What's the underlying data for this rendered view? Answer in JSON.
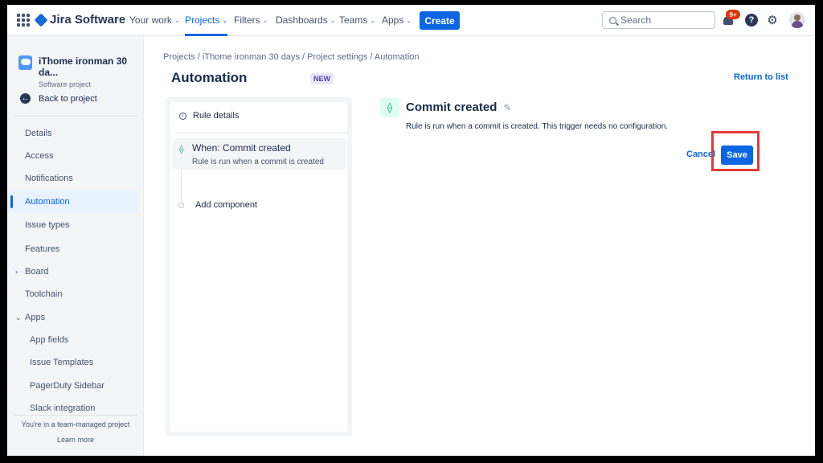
{
  "nav": {
    "app_name": "Jira Software",
    "items": [
      {
        "label": "Your work",
        "active": false
      },
      {
        "label": "Projects",
        "active": true
      },
      {
        "label": "Filters",
        "active": false
      },
      {
        "label": "Dashboards",
        "active": false
      },
      {
        "label": "Teams",
        "active": false
      },
      {
        "label": "Apps",
        "active": false
      }
    ],
    "create_label": "Create",
    "search_placeholder": "Search",
    "notification_badge": "9+",
    "help_glyph": "?"
  },
  "sidebar": {
    "project_name": "iThome ironman 30 da...",
    "project_type": "Software project",
    "back_label": "Back to project",
    "items": [
      {
        "label": "Details"
      },
      {
        "label": "Access"
      },
      {
        "label": "Notifications"
      },
      {
        "label": "Automation",
        "active": true
      },
      {
        "label": "Issue types"
      },
      {
        "label": "Features"
      },
      {
        "label": "Board",
        "caret": "›"
      },
      {
        "label": "Toolchain"
      },
      {
        "label": "Apps",
        "caret": "⌄"
      },
      {
        "label": "App fields"
      },
      {
        "label": "Issue Templates"
      },
      {
        "label": "PagerDuty Sidebar"
      },
      {
        "label": "Slack integration"
      }
    ],
    "footer_text": "You're in a team-managed project",
    "footer_link": "Learn more"
  },
  "main": {
    "breadcrumb": "Projects  /  iThome ironman 30 days  /  Project settings  /  Automation",
    "title": "Automation",
    "new_lozenge": "NEW",
    "return_link": "Return to list",
    "rule_details_label": "Rule details",
    "trigger_title": "When: Commit created",
    "trigger_subtitle": "Rule is run when a commit is created",
    "add_component_label": "Add component",
    "component_title": "Commit created",
    "component_desc": "Rule is run when a commit is created. This trigger needs no configuration.",
    "cancel_label": "Cancel",
    "save_label": "Save"
  },
  "colors": {
    "brand_blue": "#0c66e4",
    "highlight_red": "#e53935",
    "trigger_green": "#22a06b"
  }
}
